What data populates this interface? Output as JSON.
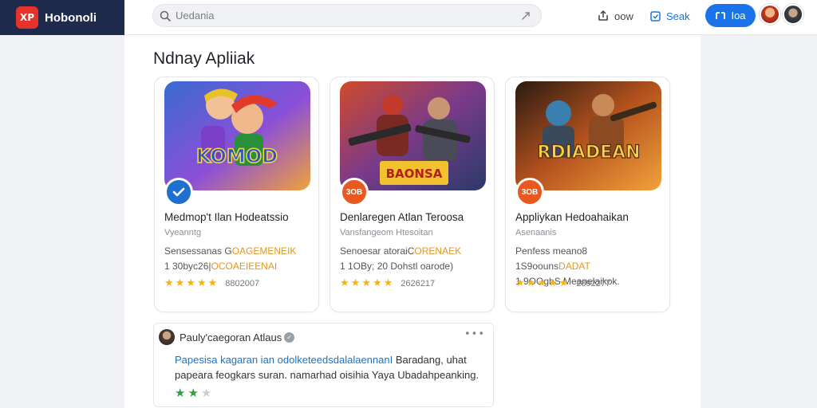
{
  "brand": {
    "logo_text": "XP",
    "name": "Hobonoli"
  },
  "search": {
    "placeholder": "Uedania"
  },
  "topbar": {
    "button1_label": "oow",
    "button2_label": "Seak",
    "primary_label": "Ioa"
  },
  "section": {
    "title": "Ndnay Apliiak"
  },
  "cards": [
    {
      "title": "Medmop't Ilan Hodeatssio",
      "subtitle": "Vyeanntg",
      "desc_plain_1": "Sensessanas G",
      "desc_hl_1": "OAGEMENEIK",
      "desc_plain_2": "1 30byc26|",
      "desc_hl_2": "OCOAEIEENAI",
      "rating_count": "8802007",
      "badge": "check",
      "colors": {
        "badge": "#1f6fd1"
      }
    },
    {
      "title": "Denlaregen Atlan Teroosa",
      "subtitle": "Vansfangeom Htesoitan",
      "desc_plain_1": "Senoesar atoraiC",
      "desc_hl_1": "ORENAEK",
      "desc_plain_2": "1 1OBy; 20 Dohstl oarode)",
      "desc_hl_2": "",
      "rating_count": "2626217",
      "badge_text": "3OB",
      "colors": {
        "badge": "#e8581f"
      }
    },
    {
      "title": "Appliykan Hedoahaikan",
      "subtitle": "Asenaanis",
      "desc_plain_1": "Penfess meano8 1S9oouns",
      "desc_hl_1": "DADAT",
      "desc_plain_2": "1 9OOgbS Meanelaikok.",
      "desc_hl_2": "",
      "rating_count": "2892277",
      "badge_text": "3OB",
      "colors": {
        "badge": "#e8581f"
      }
    }
  ],
  "review": {
    "name": "Pauly'caegoran Atlaus",
    "text_link": "Papesisa kagaran ian odolketeedsdalalaennanI",
    "text_plain_1": "Baradang, uhat",
    "text_plain_2": "papeara feogkars suran. namarhad oisihia Yaya Ubadahpeanking.",
    "stars_on": 2,
    "stars_total": 3
  },
  "colors": {
    "brand_bg": "#1f2b4d",
    "accent": "#1a73e8",
    "star": "#f5b50a",
    "review_star": "#2ea043"
  }
}
